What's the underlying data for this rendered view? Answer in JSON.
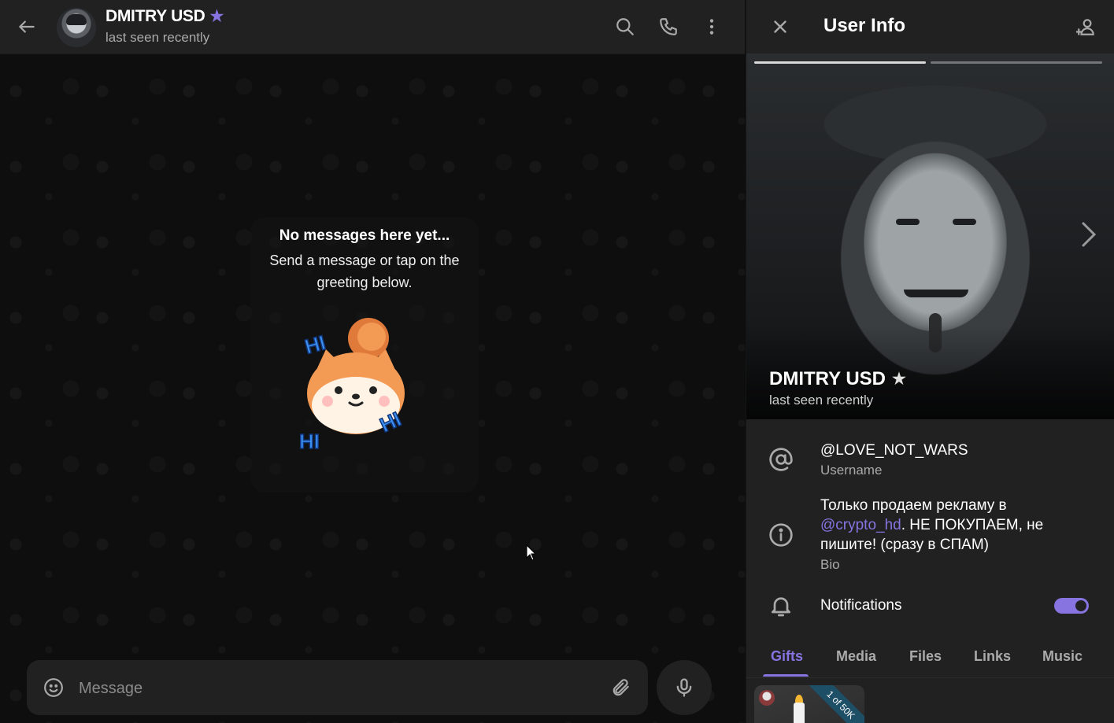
{
  "chat": {
    "header": {
      "name": "DMITRY USD",
      "status": "last seen recently",
      "icons": [
        "back-arrow-icon",
        "search-icon",
        "phone-icon",
        "more-vertical-icon"
      ]
    },
    "empty_state": {
      "title": "No messages here yet...",
      "subtitle": "Send a message or tap on the greeting below."
    },
    "composer": {
      "placeholder": "Message",
      "icons": [
        "emoji-icon",
        "attach-icon",
        "microphone-icon"
      ]
    }
  },
  "user_info": {
    "title": "User Info",
    "name": "DMITRY USD",
    "status": "last seen recently",
    "username": "@LOVE_NOT_WARS",
    "username_label": "Username",
    "bio_prefix": "Только продаем рекламу в ",
    "bio_link": "@crypto_hd",
    "bio_suffix": ". НЕ ПОКУПАЕМ, не пишите! (сразу в СПАМ)",
    "bio_label": "Bio",
    "notifications_label": "Notifications",
    "notifications_enabled": true,
    "tabs": [
      "Gifts",
      "Media",
      "Files",
      "Links",
      "Music"
    ],
    "active_tab": "Gifts",
    "gift": {
      "badge": "1 of 50K"
    }
  },
  "colors": {
    "accent": "#8774e1",
    "panel_bg": "#212121",
    "chat_bg": "#0e0e0e",
    "secondary_text": "#aaaaaa"
  }
}
